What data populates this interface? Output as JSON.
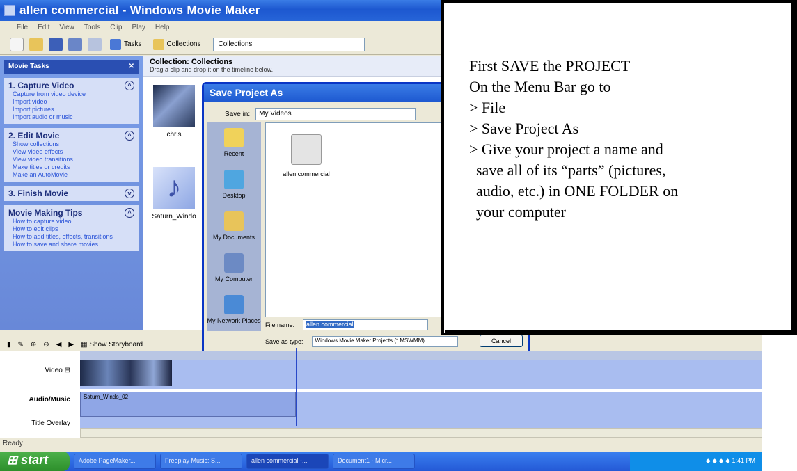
{
  "window": {
    "title": "allen commercial - Windows Movie Maker"
  },
  "menubar": [
    "File",
    "Edit",
    "View",
    "Tools",
    "Clip",
    "Play",
    "Help"
  ],
  "toolbar": {
    "tasks_label": "Tasks",
    "collections_label": "Collections",
    "collections_dropdown_value": "Collections"
  },
  "tasks_pane": {
    "header": "Movie Tasks",
    "sections": [
      {
        "title": "1. Capture Video",
        "links": [
          "Capture from video device",
          "Import video",
          "Import pictures",
          "Import audio or music"
        ]
      },
      {
        "title": "2. Edit Movie",
        "links": [
          "Show collections",
          "View video effects",
          "View video transitions",
          "Make titles or credits",
          "Make an AutoMovie"
        ]
      },
      {
        "title": "3. Finish Movie",
        "links": []
      },
      {
        "title": "Movie Making Tips",
        "links": [
          "How to capture video",
          "How to edit clips",
          "How to add titles, effects, transitions",
          "How to save and share movies"
        ]
      }
    ]
  },
  "collection": {
    "title": "Collection: Collections",
    "subtitle": "Drag a clip and drop it on the timeline below.",
    "clips": [
      {
        "caption": "chris"
      },
      {
        "caption": "Saturn_Windo"
      }
    ]
  },
  "dialog": {
    "title": "Save Project As",
    "save_in_label": "Save in:",
    "save_in_value": "My Videos",
    "places": [
      "Recent",
      "Desktop",
      "My Documents",
      "My Computer",
      "My Network Places"
    ],
    "file_item": "allen commercial",
    "filename_label": "File name:",
    "filename_value": "allen commercial",
    "save_as_type_label": "Save as type:",
    "save_as_type_value": "Windows Movie Maker Projects (*.MSWMM)",
    "cancel_label": "Cancel"
  },
  "timeline": {
    "show_storyboard_label": "Show Storyboard",
    "tracks": [
      "Video",
      "Audio/Music",
      "Title Overlay"
    ],
    "audio_clip_label": "Saturn_Windo_02"
  },
  "statusbar": {
    "text": "Ready"
  },
  "taskbar": {
    "start_label": "start",
    "buttons": [
      "Adobe PageMaker...",
      "Freeplay Music: S...",
      "allen commercial -...",
      "Document1 - Micr..."
    ],
    "clock": "1:41 PM"
  },
  "instructions": {
    "lines": [
      "First SAVE the PROJECT",
      "On the Menu Bar go to",
      "> File",
      "> Save Project As",
      "> Give your project a name and",
      "save all of its “parts” (pictures,",
      "audio, etc.) in ONE FOLDER on",
      "your computer"
    ]
  },
  "colors": {
    "xp_blue": "#1d58d0",
    "taskbar_start_green": "#2d8f2b",
    "window_bg": "#ece9d8"
  }
}
